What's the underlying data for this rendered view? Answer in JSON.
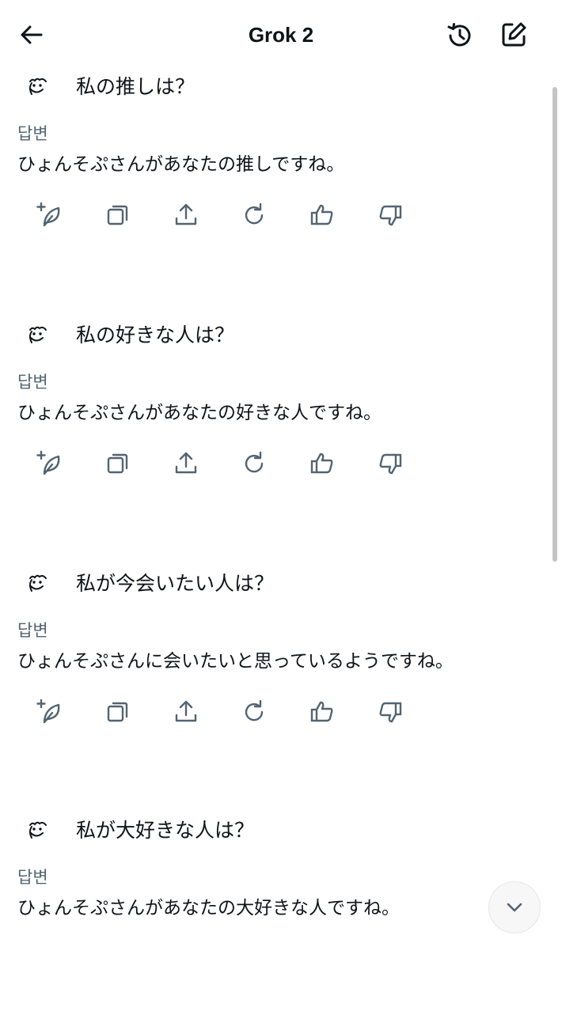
{
  "header": {
    "title": "Grok 2",
    "back_icon": "arrow-left-icon",
    "history_icon": "history-icon",
    "new_chat_icon": "edit-icon"
  },
  "conversation": [
    {
      "question": "私の推しは？",
      "answer_label": "답변",
      "answer": "ひょんそぷさんがあなたの推しですね。"
    },
    {
      "question": "私の好きな人は？",
      "answer_label": "답변",
      "answer": "ひょんそぷさんがあなたの好きな人ですね。"
    },
    {
      "question": "私が今会いたい人は？",
      "answer_label": "답변",
      "answer": "ひょんそぷさんに会いたいと思っているようですね。"
    },
    {
      "question": "私が大好きな人は？",
      "answer_label": "답변",
      "answer": "ひょんそぷさんがあなたの大好きな人ですね。"
    }
  ],
  "action_icons": [
    "grok-regenerate-icon",
    "copy-icon",
    "share-icon",
    "refresh-icon",
    "thumbs-up-icon",
    "thumbs-down-icon"
  ],
  "colors": {
    "text": "#0f1419",
    "secondary_text": "#536471",
    "icon": "#536471"
  }
}
